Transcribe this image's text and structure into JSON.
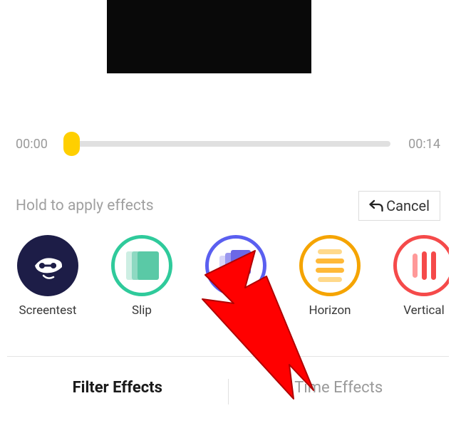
{
  "timeline": {
    "start_time": "00:00",
    "end_time": "00:14"
  },
  "instruction": "Hold to apply effects",
  "cancel_label": "Cancel",
  "effects": [
    {
      "label": "Screentest"
    },
    {
      "label": "Slip"
    },
    {
      "label": ""
    },
    {
      "label": "Horizon"
    },
    {
      "label": "Vertical"
    }
  ],
  "tabs": {
    "filter": "Filter Effects",
    "time": "Time Effects"
  }
}
